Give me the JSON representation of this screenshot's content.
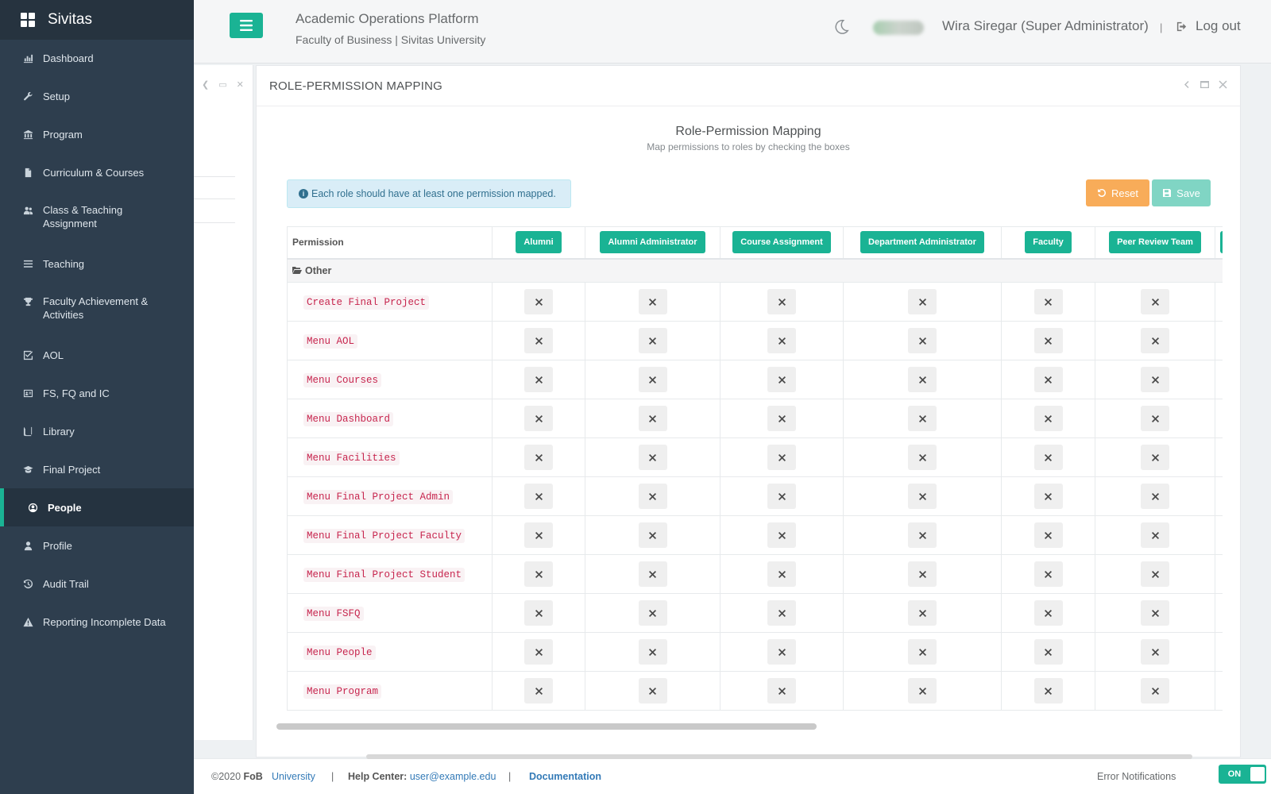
{
  "brand": {
    "name": "Sivitas"
  },
  "sidebar": {
    "items": [
      {
        "label": "Dashboard",
        "icon": "bar-chart-icon"
      },
      {
        "label": "Setup",
        "icon": "wrench-icon"
      },
      {
        "label": "Program",
        "icon": "university-icon"
      },
      {
        "label": "Curriculum & Courses",
        "icon": "file-icon"
      },
      {
        "label": "Class & Teaching Assignment",
        "icon": "users-icon"
      },
      {
        "label": "Teaching",
        "icon": "list-icon"
      },
      {
        "label": "Faculty Achievement & Activities",
        "icon": "trophy-icon"
      },
      {
        "label": "AOL",
        "icon": "check-square-icon"
      },
      {
        "label": "FS, FQ and IC",
        "icon": "id-card-icon"
      },
      {
        "label": "Library",
        "icon": "book-icon"
      },
      {
        "label": "Final Project",
        "icon": "graduation-cap-icon"
      },
      {
        "label": "People",
        "icon": "user-circle-icon",
        "active": true
      },
      {
        "label": "Profile",
        "icon": "user-icon"
      },
      {
        "label": "Audit Trail",
        "icon": "history-icon"
      },
      {
        "label": "Reporting Incomplete Data",
        "icon": "warning-icon"
      }
    ]
  },
  "header": {
    "title": "Academic Operations Platform",
    "subtitle": "Faculty of Business | Sivitas University",
    "user": "Wira Siregar (Super Administrator)",
    "separator": "|",
    "logout": "Log out"
  },
  "panel": {
    "title": "ROLE-PERMISSION MAPPING",
    "heading": "Role-Permission Mapping",
    "subheading": "Map permissions to roles by checking the boxes",
    "alert": "Each role should have at least one permission mapped.",
    "reset_label": "Reset",
    "save_label": "Save"
  },
  "table": {
    "permission_header": "Permission",
    "roles": [
      "Alumni",
      "Alumni Administrator",
      "Course Assignment",
      "Department Administrator",
      "Faculty",
      "Peer Review Team"
    ],
    "group": "Other",
    "permissions": [
      "Create Final Project",
      "Menu AOL",
      "Menu Courses",
      "Menu Dashboard",
      "Menu Facilities",
      "Menu Final Project Admin",
      "Menu Final Project Faculty",
      "Menu Final Project Student",
      "Menu FSFQ",
      "Menu People",
      "Menu Program"
    ],
    "cell_state": "unchecked"
  },
  "footer": {
    "copyright": "©2020",
    "fob": "FoB",
    "university": "University",
    "sep": "|",
    "help_label": "Help Center:",
    "help_email": "user@example.edu",
    "documentation": "Documentation",
    "error_notifications": "Error Notifications",
    "toggle": "ON"
  },
  "colors": {
    "sidebar": "#2e3e4e",
    "accent": "#1ab394",
    "warning": "#f8ac59",
    "code_text": "#c7254e",
    "alert_bg": "#d9edf7"
  }
}
